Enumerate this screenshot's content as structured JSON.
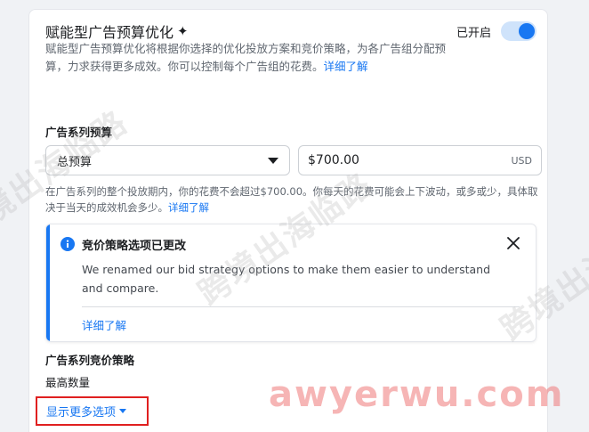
{
  "campaign_budget_optimization": {
    "title": "赋能型广告预算优化",
    "sparkle": "✦",
    "description": "赋能型广告预算优化将根据你选择的优化投放方案和竞价策略，为各广告组分配预算，力求获得更多成效。你可以控制每个广告组的花费。",
    "learn_more": "详细了解",
    "toggle_label": "已开启",
    "toggle_on": true
  },
  "campaign_budget": {
    "label": "广告系列预算",
    "budget_type": "总预算",
    "amount": "$700.00",
    "currency": "USD",
    "note": "在广告系列的整个投放期内，你的花费不会超过$700.00。你每天的花费可能会上下波动，或多或少，具体取决于当天的成效机会多少。",
    "note_learn_more": "详细了解"
  },
  "notice": {
    "title": "竞价策略选项已更改",
    "body": "We renamed our bid strategy options to make them easier to understand and compare.",
    "learn_more": "详细了解"
  },
  "bid_strategy": {
    "label": "广告系列竞价策略",
    "value": "最高数量"
  },
  "show_more_options": "显示更多选项",
  "watermark": {
    "text": "跨境出海临路",
    "url": "awyerwu.com"
  },
  "colors": {
    "accent": "#1877f2",
    "highlight_border": "#e02020",
    "watermark_url": "#ee7878"
  }
}
